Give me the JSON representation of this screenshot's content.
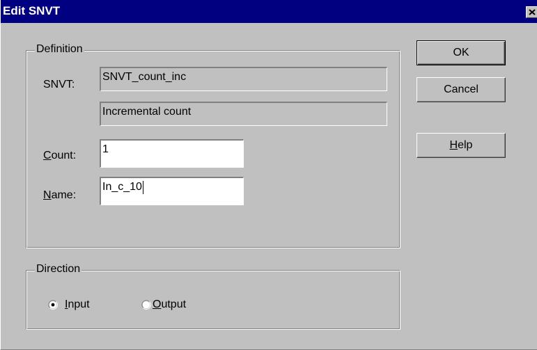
{
  "window": {
    "title": "Edit SNVT",
    "close_glyph": "✕"
  },
  "definition": {
    "legend": "Definition",
    "snvt_label": "SNVT:",
    "snvt_value": "SNVT_count_inc",
    "snvt_description": "Incremental count",
    "count_label_prefix": "",
    "count_label_mnemonic": "C",
    "count_label_rest": "ount:",
    "count_value": "1",
    "name_label_mnemonic": "N",
    "name_label_rest": "ame:",
    "name_value": "In_c_10"
  },
  "direction": {
    "legend": "Direction",
    "options": [
      {
        "mnemonic": "I",
        "rest": "nput",
        "selected": true
      },
      {
        "mnemonic": "O",
        "rest": "utput",
        "selected": false
      }
    ]
  },
  "buttons": {
    "ok_label": "OK",
    "cancel_label": "Cancel",
    "help_mnemonic": "H",
    "help_rest": "elp"
  },
  "colors": {
    "titlebar": "#000080",
    "face": "#c0c0c0"
  },
  "icons": {
    "close": "close-icon",
    "radio_selected": "radio-selected-icon",
    "radio_unselected": "radio-unselected-icon"
  }
}
